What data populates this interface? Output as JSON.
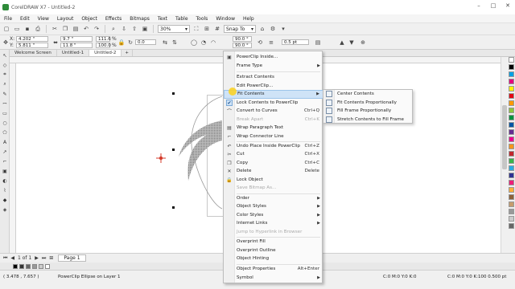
{
  "window": {
    "title": "CorelDRAW X7 - Untitled-2",
    "controls": [
      "–",
      "□",
      "✕"
    ]
  },
  "menubar": {
    "items": [
      "File",
      "Edit",
      "View",
      "Layout",
      "Object",
      "Effects",
      "Bitmaps",
      "Text",
      "Table",
      "Tools",
      "Window",
      "Help"
    ]
  },
  "toolbar1": {
    "zoom": "30%",
    "snap_label": "Snap To"
  },
  "toolbar2": {
    "x_label": "X:",
    "x_value": "4.202 \"",
    "y_label": "Y:",
    "y_value": "5.811 \"",
    "w_value": "9.7 \"",
    "h_value": "11.8 \"",
    "sx_value": "111.6",
    "sy_value": "100.0",
    "pct": "%",
    "rotation": "0.0",
    "angle1": "90.0 °",
    "angle2": "90.0 °",
    "outline_width": "0.5 pt"
  },
  "tabs": [
    {
      "label": "Welcome Screen"
    },
    {
      "label": "Untitled-1"
    },
    {
      "label": "Untitled-2"
    }
  ],
  "context_menu": {
    "items": [
      {
        "label": "PowerClip Inside...",
        "shortcut": "",
        "submenu": false,
        "disabled": false
      },
      {
        "label": "Frame Type",
        "shortcut": "",
        "submenu": true,
        "disabled": false
      },
      {
        "label": "Extract Contents",
        "shortcut": "",
        "submenu": false,
        "disabled": false
      },
      {
        "label": "Edit PowerClip...",
        "shortcut": "",
        "submenu": false,
        "disabled": false
      },
      {
        "label": "Fit Contents",
        "shortcut": "",
        "submenu": true,
        "disabled": false
      },
      {
        "label": "Lock Contents to PowerClip",
        "shortcut": "",
        "submenu": false,
        "disabled": false
      },
      {
        "label": "Convert to Curves",
        "shortcut": "Ctrl+Q",
        "submenu": false,
        "disabled": false
      },
      {
        "label": "Break Apart",
        "shortcut": "Ctrl+K",
        "submenu": false,
        "disabled": true
      },
      {
        "label": "Wrap Paragraph Text",
        "shortcut": "",
        "submenu": false,
        "disabled": false
      },
      {
        "label": "Wrap Connector Line",
        "shortcut": "",
        "submenu": false,
        "disabled": false
      },
      {
        "label": "Undo Place Inside PowerClip",
        "shortcut": "Ctrl+Z",
        "submenu": false,
        "disabled": false
      },
      {
        "label": "Cut",
        "shortcut": "Ctrl+X",
        "submenu": false,
        "disabled": false
      },
      {
        "label": "Copy",
        "shortcut": "Ctrl+C",
        "submenu": false,
        "disabled": false
      },
      {
        "label": "Delete",
        "shortcut": "Delete",
        "submenu": false,
        "disabled": false
      },
      {
        "label": "Lock Object",
        "shortcut": "",
        "submenu": false,
        "disabled": false
      },
      {
        "label": "Save Bitmap As...",
        "shortcut": "",
        "submenu": false,
        "disabled": true
      },
      {
        "label": "Order",
        "shortcut": "",
        "submenu": true,
        "disabled": false
      },
      {
        "label": "Object Styles",
        "shortcut": "",
        "submenu": true,
        "disabled": false
      },
      {
        "label": "Color Styles",
        "shortcut": "",
        "submenu": true,
        "disabled": false
      },
      {
        "label": "Internet Links",
        "shortcut": "",
        "submenu": true,
        "disabled": false
      },
      {
        "label": "Jump to Hyperlink in Browser",
        "shortcut": "",
        "submenu": false,
        "disabled": true
      },
      {
        "label": "Overprint Fill",
        "shortcut": "",
        "submenu": false,
        "disabled": false
      },
      {
        "label": "Overprint Outline",
        "shortcut": "",
        "submenu": false,
        "disabled": false
      },
      {
        "label": "Object Hinting",
        "shortcut": "",
        "submenu": false,
        "disabled": false
      },
      {
        "label": "Object Properties",
        "shortcut": "Alt+Enter",
        "submenu": false,
        "disabled": false
      },
      {
        "label": "Symbol",
        "shortcut": "",
        "submenu": true,
        "disabled": false
      }
    ]
  },
  "fit_submenu": {
    "items": [
      {
        "label": "Center Contents"
      },
      {
        "label": "Fit Contents Proportionally"
      },
      {
        "label": "Fill Frame Proportionally"
      },
      {
        "label": "Stretch Contents to Fill Frame"
      }
    ]
  },
  "pagebar": {
    "position": "1 of 1",
    "page_tab": "Page 1"
  },
  "statusbar": {
    "coords": "( 3.478 , 7.657 )",
    "info": "PowerClip Ellipse on Layer 1",
    "fill_info": "C:0 M:0 Y:0 K:0",
    "outline_info": "C:0 M:0 Y:0 K:100  0.500 pt"
  },
  "colors": {
    "accent": "#cfe3f7",
    "menu_bg": "#fafafa",
    "ui_bg": "#f0f0f0"
  }
}
